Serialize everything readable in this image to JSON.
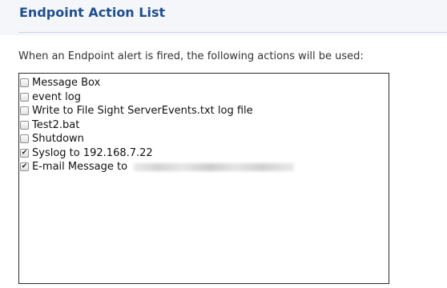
{
  "section": {
    "title": "Endpoint Action List",
    "description": "When an Endpoint alert is fired, the following actions will be used:"
  },
  "actions": [
    {
      "label": "Message Box",
      "checked": false
    },
    {
      "label": "event log",
      "checked": false
    },
    {
      "label": "Write to File Sight ServerEvents.txt log file",
      "checked": false
    },
    {
      "label": "Test2.bat",
      "checked": false
    },
    {
      "label": "Shutdown",
      "checked": false
    },
    {
      "label": "Syslog to 192.168.7.22",
      "checked": true
    },
    {
      "label": "E-mail Message to",
      "checked": true
    }
  ],
  "colors": {
    "title": "#1f4f8e",
    "header_background": "#f4f6f9"
  }
}
